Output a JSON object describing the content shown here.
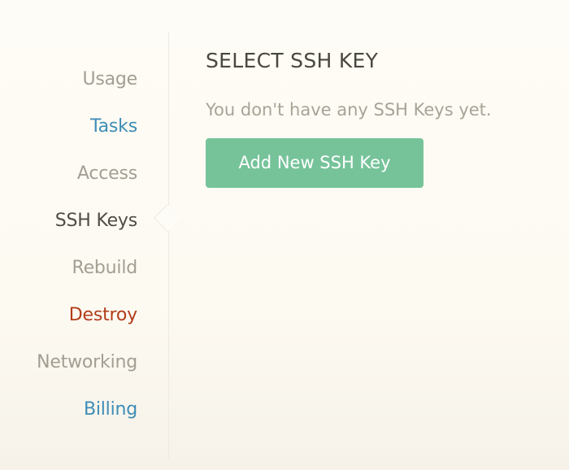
{
  "sidebar": {
    "items": [
      {
        "label": "Usage",
        "state": "muted"
      },
      {
        "label": "Tasks",
        "state": "link"
      },
      {
        "label": "Access",
        "state": "muted"
      },
      {
        "label": "SSH Keys",
        "state": "active"
      },
      {
        "label": "Rebuild",
        "state": "muted"
      },
      {
        "label": "Destroy",
        "state": "danger"
      },
      {
        "label": "Networking",
        "state": "muted"
      },
      {
        "label": "Billing",
        "state": "link"
      }
    ]
  },
  "main": {
    "title": "SELECT SSH KEY",
    "empty_message": "You don't have any SSH Keys yet.",
    "add_button_label": "Add New SSH Key"
  },
  "colors": {
    "muted": "#a39e92",
    "link": "#3e8db6",
    "active": "#4f4b45",
    "danger": "#b23d1a",
    "button": "#76c39a"
  }
}
